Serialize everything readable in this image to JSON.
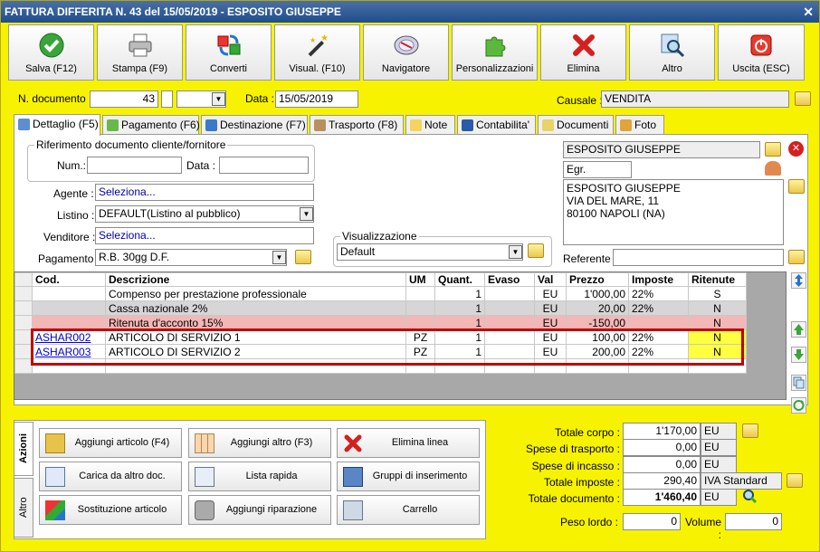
{
  "title": "FATTURA DIFFERITA N. 43 del 15/05/2019 - ESPOSITO GIUSEPPE",
  "toolbar": [
    {
      "label": "Salva (F12)",
      "icon": "check-icon"
    },
    {
      "label": "Stampa (F9)",
      "icon": "printer-icon"
    },
    {
      "label": "Converti",
      "icon": "convert-icon"
    },
    {
      "label": "Visual. (F10)",
      "icon": "magic-wand-icon"
    },
    {
      "label": "Navigatore",
      "icon": "compass-icon"
    },
    {
      "label": "Personalizzazioni",
      "icon": "puzzle-icon"
    },
    {
      "label": "Elimina",
      "icon": "red-x-icon"
    },
    {
      "label": "Altro",
      "icon": "magnifier-icon"
    },
    {
      "label": "Uscita (ESC)",
      "icon": "power-icon"
    }
  ],
  "header": {
    "ndoc_label": "N. documento :",
    "ndoc_value": "43",
    "data_label": "Data :",
    "data_value": "15/05/2019",
    "causale_label": "Causale :",
    "causale_value": "VENDITA"
  },
  "tabs": [
    "Dettaglio (F5)",
    "Pagamento (F6)",
    "Destinazione (F7)",
    "Trasporto (F8)",
    "Note",
    "Contabilita'",
    "Documenti",
    "Foto"
  ],
  "rif": {
    "legend": "Riferimento documento cliente/fornitore",
    "num_label": "Num.:",
    "data_label": "Data :"
  },
  "fields": {
    "agente_label": "Agente :",
    "agente_value": "Seleziona...",
    "listino_label": "Listino :",
    "listino_value": "DEFAULT(Listino al pubblico)",
    "venditore_label": "Venditore :",
    "venditore_value": "Seleziona...",
    "pagamento_label": "Pagamento :",
    "pagamento_value": "R.B. 30gg D.F."
  },
  "visual": {
    "legend": "Visualizzazione",
    "value": "Default"
  },
  "cliente": {
    "name": "ESPOSITO GIUSEPPE",
    "title": "Egr.",
    "address": [
      "ESPOSITO GIUSEPPE",
      "VIA DEL MARE, 11",
      "80100 NAPOLI (NA)"
    ],
    "referente_label": "Referente"
  },
  "grid": {
    "headers": [
      "Cod.",
      "Descrizione",
      "UM",
      "Quant.",
      "Evaso",
      "Val",
      "Prezzo",
      "Imposte",
      "Ritenute"
    ],
    "rows": [
      {
        "cod": "",
        "desc": "Compenso per prestazione professionale",
        "um": "",
        "qty": "1",
        "evaso": "",
        "val": "EU",
        "price": "1'000,00",
        "tax": "22%",
        "rit": "S",
        "style": "white"
      },
      {
        "cod": "",
        "desc": "Cassa nazionale 2%",
        "um": "",
        "qty": "1",
        "evaso": "",
        "val": "EU",
        "price": "20,00",
        "tax": "22%",
        "rit": "N",
        "style": "gray"
      },
      {
        "cod": "",
        "desc": "Ritenuta d'acconto 15%",
        "um": "",
        "qty": "1",
        "evaso": "",
        "val": "EU",
        "price": "-150,00",
        "tax": "",
        "rit": "N",
        "style": "pink"
      },
      {
        "cod": "ASHAR002",
        "desc": "ARTICOLO DI SERVIZIO 1",
        "um": "PZ",
        "qty": "1",
        "evaso": "",
        "val": "EU",
        "price": "100,00",
        "tax": "22%",
        "rit": "N",
        "style": "white"
      },
      {
        "cod": "ASHAR003",
        "desc": "ARTICOLO DI SERVIZIO 2",
        "um": "PZ",
        "qty": "1",
        "evaso": "",
        "val": "EU",
        "price": "200,00",
        "tax": "22%",
        "rit": "N",
        "style": "white"
      }
    ]
  },
  "actions": {
    "tab1": "Azioni",
    "tab2": "Altro",
    "buttons": [
      "Aggiungi articolo (F4)",
      "Aggiungi altro (F3)",
      "Elimina linea",
      "Carica da altro doc.",
      "Lista rapida",
      "Gruppi di inserimento",
      "Sostituzione articolo",
      "Aggiungi riparazione",
      "Carrello"
    ]
  },
  "totals": {
    "corpo_label": "Totale corpo :",
    "corpo": "1'170,00",
    "corpo_cur": "EU",
    "trasporto_label": "Spese di trasporto :",
    "trasporto": "0,00",
    "trasporto_cur": "EU",
    "incasso_label": "Spese di incasso :",
    "incasso": "0,00",
    "incasso_cur": "EU",
    "imposte_label": "Totale imposte :",
    "imposte": "290,40",
    "imposte_cur": "IVA Standard",
    "documento_label": "Totale documento :",
    "documento": "1'460,40",
    "documento_cur": "EU",
    "peso_label": "Peso lordo :",
    "peso": "0",
    "volume_label": "Volume :",
    "volume": "0"
  },
  "colors": {
    "yellow": "#f7f300",
    "pink": "#f4b7b7",
    "gray": "#d6d6d6",
    "highlight": "#ffff40",
    "red": "#c00000"
  }
}
